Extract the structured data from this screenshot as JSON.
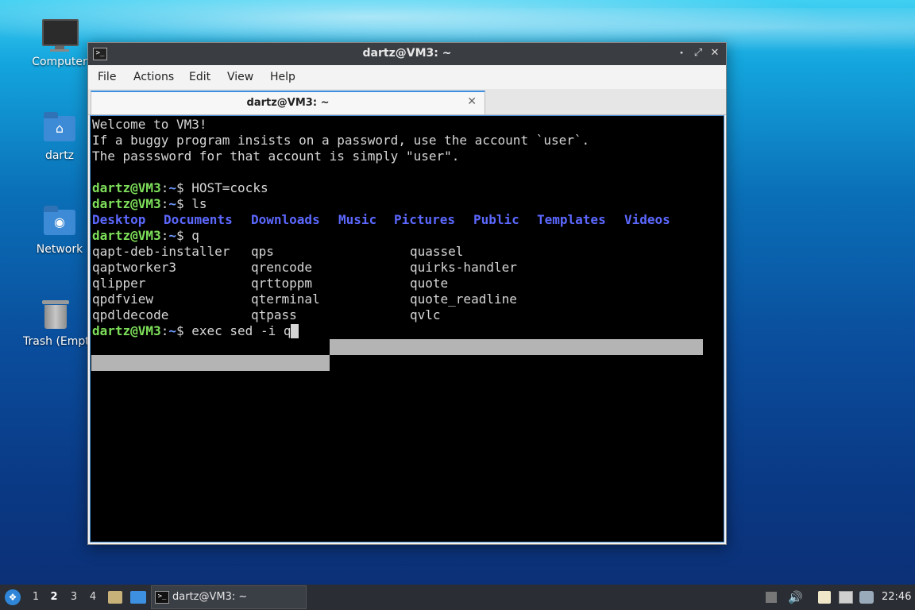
{
  "desktop": {
    "icons": [
      {
        "label": "Computer"
      },
      {
        "label": "dartz"
      },
      {
        "label": "Network"
      },
      {
        "label": "Trash (Empty)"
      }
    ]
  },
  "window": {
    "title": "dartz@VM3: ~",
    "menu": [
      "File",
      "Actions",
      "Edit",
      "View",
      "Help"
    ],
    "tab_title": "dartz@VM3: ~",
    "controls": {
      "minimize": "⬝",
      "maximize": "⤢",
      "close": "✕"
    }
  },
  "terminal": {
    "welcome": "Welcome to VM3!",
    "notice1": "If a buggy program insists on a password, use the account `user`.",
    "notice2": "The passsword for that account is simply \"user\".",
    "prompt_user": "dartz@VM3",
    "prompt_sep": ":",
    "prompt_path": "~",
    "prompt_dollar": "$ ",
    "cmd1": "HOST=cocks",
    "cmd2": "ls",
    "dirs": [
      "Desktop",
      "Documents",
      "Downloads",
      "Music",
      "Pictures",
      "Public",
      "Templates",
      "Videos"
    ],
    "cmd3": "q",
    "completions": [
      [
        "qapt-deb-installer",
        "qps",
        "quassel"
      ],
      [
        "qaptworker3",
        "qrencode",
        "quirks-handler"
      ],
      [
        "qlipper",
        "qrttoppm",
        "quote"
      ],
      [
        "qpdfview",
        "qterminal",
        "quote_readline"
      ],
      [
        "qpdldecode",
        "qtpass",
        "qvlc"
      ]
    ],
    "cmd4": "exec sed -i q"
  },
  "taskbar": {
    "workspaces": [
      "1",
      "2",
      "3",
      "4"
    ],
    "active_workspace": "2",
    "task_label": "dartz@VM3: ~",
    "clock": "22:46"
  }
}
